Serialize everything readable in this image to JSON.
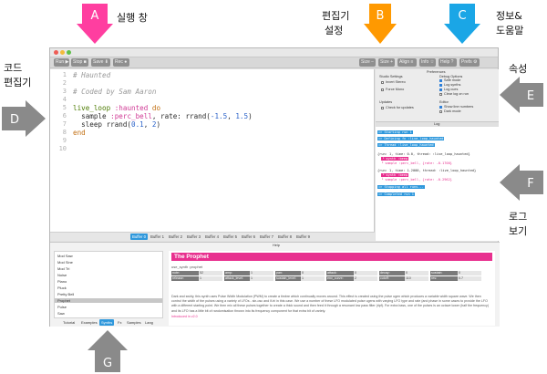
{
  "annotations": {
    "A": {
      "letter": "A",
      "label": "실행 창",
      "color": "#ff3ea0"
    },
    "B": {
      "letter": "B",
      "label_line1": "편집기",
      "label_line2": "설정",
      "color": "#ff9900"
    },
    "C": {
      "letter": "C",
      "label_line1": "정보&",
      "label_line2": "도움말",
      "color": "#1aa6e6"
    },
    "D": {
      "letter": "D",
      "label_line1": "코드",
      "label_line2": "편집기",
      "color": "#8a8a8a"
    },
    "E": {
      "letter": "E",
      "label": "속성",
      "color": "#8a8a8a"
    },
    "F": {
      "letter": "F",
      "label_line1": "로그",
      "label_line2": "보기",
      "color": "#8a8a8a"
    },
    "G": {
      "letter": "G",
      "color": "#8a8a8a"
    }
  },
  "toolbar": {
    "run": "Run",
    "stop": "Stop",
    "save": "Save",
    "rec": "Rec",
    "size_minus": "Size",
    "size_plus": "Size",
    "align": "Align",
    "info": "Info",
    "help": "Help",
    "prefs": "Prefs"
  },
  "editor": {
    "line_numbers": [
      "1",
      "2",
      "3",
      "4",
      "5",
      "6",
      "7",
      "8",
      "9",
      "10"
    ]
  },
  "buffers": [
    "Buffer 0",
    "Buffer 1",
    "Buffer 2",
    "Buffer 3",
    "Buffer 4",
    "Buffer 5",
    "Buffer 6",
    "Buffer 7",
    "Buffer 8",
    "Buffer 9"
  ],
  "prefs": {
    "title": "Preferences",
    "studio_settings": "Studio Settings",
    "invert_stereo": "Invert Stereo",
    "force_mono": "Force Mono",
    "debug_options": "Debug Options",
    "safe_mode": "Safe mode",
    "log_synths": "Log synths",
    "log_cues": "Log cues",
    "clear_log": "Clear log on run",
    "updates": "Updates",
    "check_updates": "Check for updates",
    "editor": "Editor",
    "show_line_numbers": "Show line numbers",
    "dark_mode": "Dark mode"
  },
  "log": {
    "title": "Log",
    "l1": "=> Starting run 1",
    "l2": "=> Defining fn :live_loop_haunted",
    "l3": "=> Thread :live_loop_haunted",
    "l4": "{run: 1, time: 0.0, thread: :live_loop_haunted}",
    "l5": "└ synth :beep",
    "l6": "└ sample :perc_bell, {rate: -0.1700}",
    "l7": "{run: 1, time: 1.2000, thread: :live_loop_haunted}",
    "l8": "└ synth :beep",
    "l9": "└ sample :perc_bell, {rate: -0.2962}",
    "l10": "=> Stopping all runs...",
    "l11": "=> Completed run 1"
  },
  "help": {
    "title": "Help",
    "list": [
      "Mod Saw",
      "Mod Sine",
      "Mod Tri",
      "Noise",
      "Piano",
      "Pluck",
      "Pretty Bell",
      "Prophet",
      "Pulse",
      "Saw"
    ],
    "selected": "Prophet",
    "tabs": [
      "Tutorial",
      "Examples",
      "Synths",
      "Fx",
      "Samples",
      "Lang"
    ],
    "active_tab": "Synths",
    "doc_title": "The Prophet",
    "doc_synth": "use_synth :prophet",
    "params_row1": [
      {
        "k": "note:",
        "v": "52"
      },
      {
        "k": "amp:",
        "v": "1"
      },
      {
        "k": "pan:",
        "v": "0"
      },
      {
        "k": "attack:",
        "v": "0"
      },
      {
        "k": "decay:",
        "v": "0"
      },
      {
        "k": "sustain:",
        "v": "0"
      }
    ],
    "params_row2": [
      {
        "k": "release:",
        "v": "1"
      },
      {
        "k": "attack_level:",
        "v": "1"
      },
      {
        "k": "sustain_level:",
        "v": "1"
      },
      {
        "k": "env_curve:",
        "v": "2"
      },
      {
        "k": "cutoff:",
        "v": "110"
      },
      {
        "k": "res:",
        "v": "0.7"
      }
    ],
    "doc_paragraph": "Dark and swirly, this synth uses Pulse Width Modulation (PWM) to create a timbre which continually moves around. This effect is created using the pulse ugen which produces a variable width square wave. We then control the width of the pulses using a variety of LFOs - sin-osc and lf-tri in this case. We use a number of these LFO modulated pulse ugens with varying LFO type and rate (and phase in some cases to provide the LFO with a different starting point. We then mix all these pulses together to create a thick sound and then feed it through a resonant low pass filter (rlpf). For extra bass, one of the pulses is an octave lower (half the frequency) and its LFO has a little bit of randomisation thrown into its frequency component for that extra bit of variety.",
    "doc_intro": "Introduced in v2.0"
  }
}
